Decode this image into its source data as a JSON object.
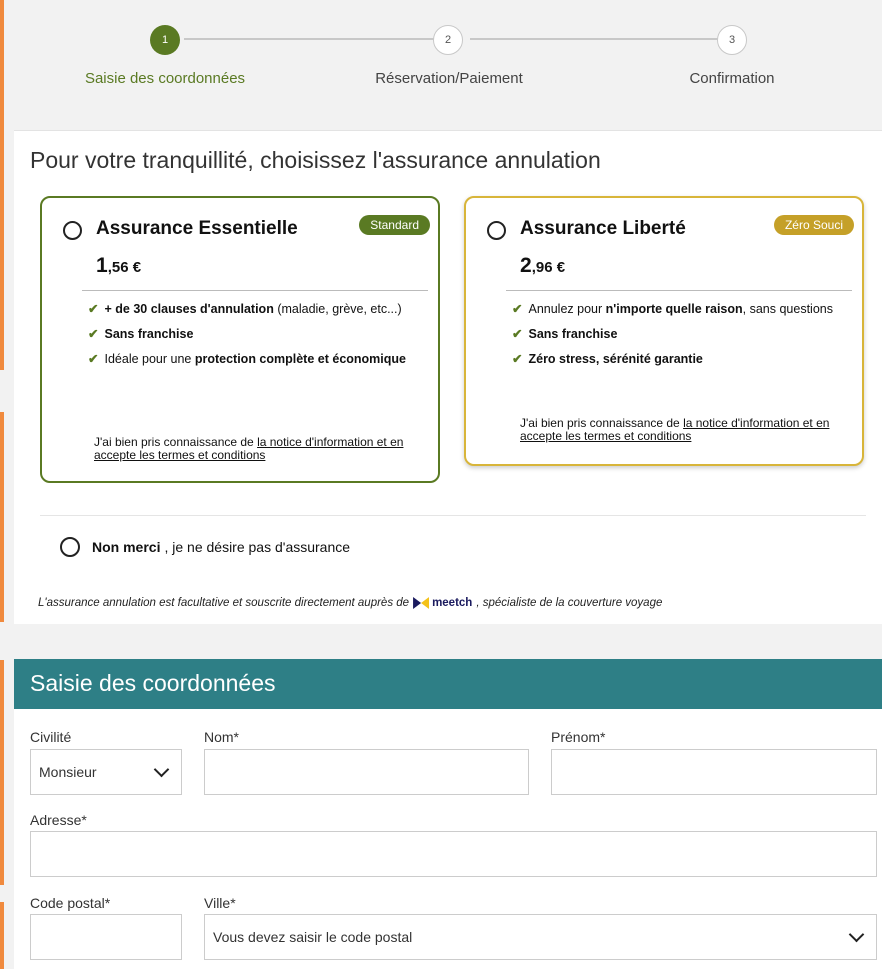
{
  "stepper": {
    "steps": [
      {
        "num": "1",
        "label": "Saisie des coordonnées"
      },
      {
        "num": "2",
        "label": "Réservation/Paiement"
      },
      {
        "num": "3",
        "label": "Confirmation"
      }
    ],
    "active_color": "#5a7a23"
  },
  "insurance": {
    "title": "Pour votre tranquillité, choisissez l'assurance annulation",
    "essentielle": {
      "name": "Assurance Essentielle",
      "badge": "Standard",
      "price_int": "1",
      "price_dec": ",56 €",
      "f1_bold": "+ de 30 clauses d'annulation",
      "f1_rest": " (maladie, grève, etc...)",
      "f2_bold": "Sans franchise",
      "f3_pre": "Idéale pour une ",
      "f3_bold": "protection complète et économique",
      "notice_pre": "J'ai bien pris connaissance de ",
      "notice_link": "la notice d'information et en accepte les termes et conditions"
    },
    "liberte": {
      "name": "Assurance Liberté",
      "badge": "Zéro Souci",
      "price_int": "2",
      "price_dec": ",96 €",
      "f1_pre": "Annulez pour ",
      "f1_bold": "n'importe quelle raison",
      "f1_rest": ", sans questions",
      "f2_bold": "Sans franchise",
      "f3_bold": "Zéro stress, sérénité garantie",
      "notice_pre": "J'ai bien pris connaissance de ",
      "notice_link": "la notice d'information et en accepte les termes et conditions"
    },
    "nomerci_bold": "Non merci",
    "nomerci_rest": ", je ne désire pas d'assurance",
    "legal_pre": "L'assurance annulation est facultative et souscrite directement auprès de",
    "meetch": "meetch",
    "legal_post": ", spécialiste de la couverture voyage",
    "green": "#5a7a23",
    "gold": "#d8b53a"
  },
  "form": {
    "header": "Saisie des coordonnées",
    "header_color": "#2e7f86",
    "civilite_label": "Civilité",
    "civilite_value": "Monsieur",
    "nom_label": "Nom*",
    "prenom_label": "Prénom*",
    "adresse_label": "Adresse*",
    "cp_label": "Code postal*",
    "ville_label": "Ville*",
    "ville_value": "Vous devez saisir le code postal"
  }
}
